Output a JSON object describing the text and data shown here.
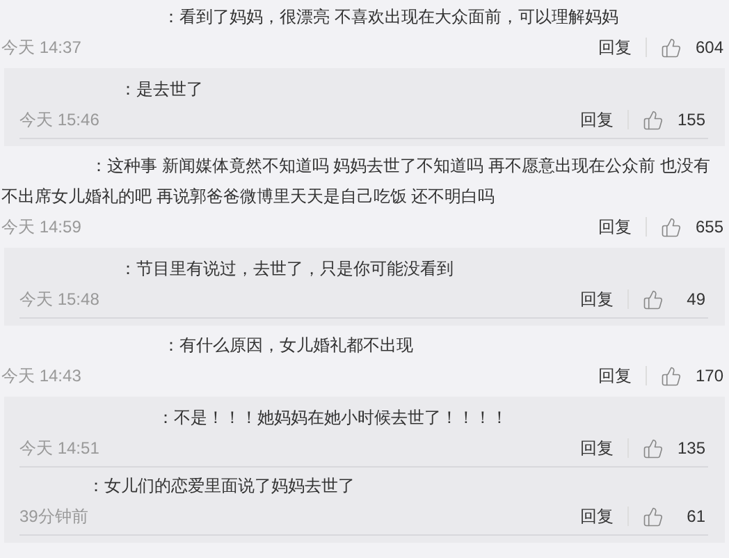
{
  "comments": [
    {
      "text": "：看到了妈妈，很漂亮 不喜欢出现在大众面前，可以理解妈妈",
      "time": "今天 14:37",
      "reply_label": "回复",
      "likes": "604",
      "replies": [
        {
          "text": "：是去世了",
          "time": "今天 15:46",
          "reply_label": "回复",
          "likes": "155"
        }
      ]
    },
    {
      "text": "：这种事 新闻媒体竟然不知道吗 妈妈去世了不知道吗 再不愿意出现在公众前 也没有不出席女儿婚礼的吧 再说郭爸爸微博里天天是自己吃饭 还不明白吗",
      "time": "今天 14:59",
      "reply_label": "回复",
      "likes": "655",
      "replies": [
        {
          "text": "：节目里有说过，去世了，只是你可能没看到",
          "time": "今天 15:48",
          "reply_label": "回复",
          "likes": "49"
        }
      ]
    },
    {
      "text": "：有什么原因，女儿婚礼都不出现",
      "time": "今天 14:43",
      "reply_label": "回复",
      "likes": "170",
      "replies": [
        {
          "text": "：不是！！！她妈妈在她小时候去世了！！！！",
          "time": "今天 14:51",
          "reply_label": "回复",
          "likes": "135"
        },
        {
          "text": "：女儿们的恋爱里面说了妈妈去世了",
          "time": "39分钟前",
          "reply_label": "回复",
          "likes": "61"
        }
      ]
    }
  ]
}
